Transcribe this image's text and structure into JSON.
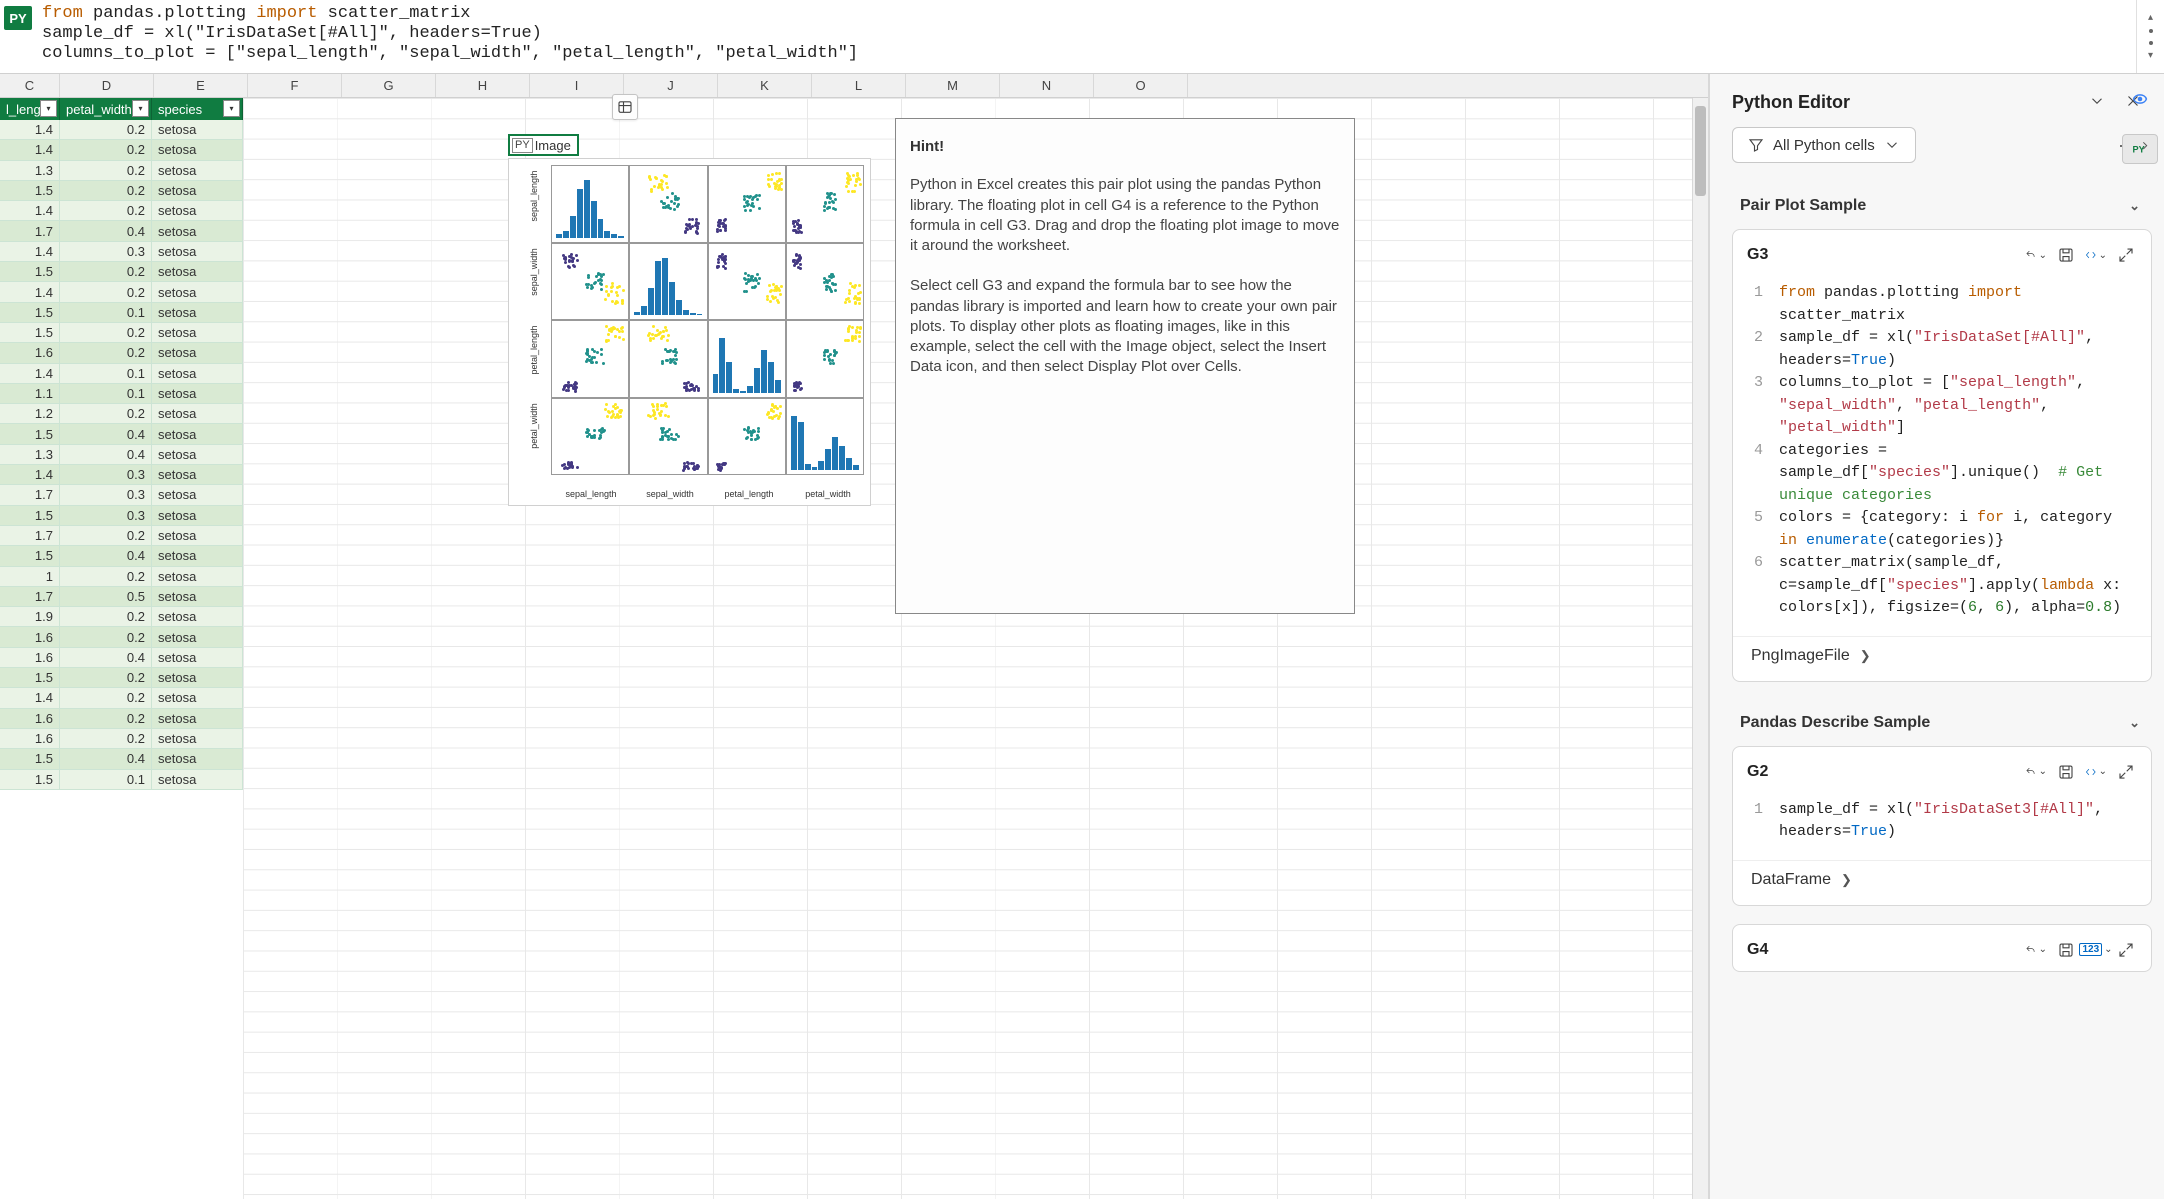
{
  "formula": {
    "indicator": "PY",
    "line1_prefix": "from",
    "line1_mod": " pandas.plotting ",
    "line1_import": "import",
    "line1_name": " scatter_matrix",
    "line2": "sample_df = xl(\"IrisDataSet[#All]\", headers=True)",
    "line3": "columns_to_plot = [\"sepal_length\", \"sepal_width\", \"petal_length\", \"petal_width\"]"
  },
  "columns": [
    "C",
    "D",
    "E",
    "F",
    "G",
    "H",
    "I",
    "J",
    "K",
    "L",
    "M",
    "N",
    "O"
  ],
  "col_w_first": 60,
  "col_w_rest": 94,
  "table_headers": [
    "l_length",
    "petal_width",
    "species"
  ],
  "table_header_widths": [
    60,
    92,
    91
  ],
  "table_rows": [
    [
      1.4,
      0.2,
      "setosa"
    ],
    [
      1.4,
      0.2,
      "setosa"
    ],
    [
      1.3,
      0.2,
      "setosa"
    ],
    [
      1.5,
      0.2,
      "setosa"
    ],
    [
      1.4,
      0.2,
      "setosa"
    ],
    [
      1.7,
      0.4,
      "setosa"
    ],
    [
      1.4,
      0.3,
      "setosa"
    ],
    [
      1.5,
      0.2,
      "setosa"
    ],
    [
      1.4,
      0.2,
      "setosa"
    ],
    [
      1.5,
      0.1,
      "setosa"
    ],
    [
      1.5,
      0.2,
      "setosa"
    ],
    [
      1.6,
      0.2,
      "setosa"
    ],
    [
      1.4,
      0.1,
      "setosa"
    ],
    [
      1.1,
      0.1,
      "setosa"
    ],
    [
      1.2,
      0.2,
      "setosa"
    ],
    [
      1.5,
      0.4,
      "setosa"
    ],
    [
      1.3,
      0.4,
      "setosa"
    ],
    [
      1.4,
      0.3,
      "setosa"
    ],
    [
      1.7,
      0.3,
      "setosa"
    ],
    [
      1.5,
      0.3,
      "setosa"
    ],
    [
      1.7,
      0.2,
      "setosa"
    ],
    [
      1.5,
      0.4,
      "setosa"
    ],
    [
      1,
      0.2,
      "setosa"
    ],
    [
      1.7,
      0.5,
      "setosa"
    ],
    [
      1.9,
      0.2,
      "setosa"
    ],
    [
      1.6,
      0.2,
      "setosa"
    ],
    [
      1.6,
      0.4,
      "setosa"
    ],
    [
      1.5,
      0.2,
      "setosa"
    ],
    [
      1.4,
      0.2,
      "setosa"
    ],
    [
      1.6,
      0.2,
      "setosa"
    ],
    [
      1.6,
      0.2,
      "setosa"
    ],
    [
      1.5,
      0.4,
      "setosa"
    ],
    [
      1.5,
      0.1,
      "setosa"
    ]
  ],
  "image_cell_label": "Image",
  "pair_plot": {
    "labels": [
      "sepal_length",
      "sepal_width",
      "petal_length",
      "petal_width"
    ]
  },
  "hint": {
    "title": "Hint!",
    "p1": "Python in Excel creates this pair plot using the pandas Python library. The floating plot in cell G4 is a reference to the Python formula in cell G3. Drag and drop the floating plot image to move it around the worksheet.",
    "p2": "Select cell G3 and expand the formula bar to see how the pandas library is imported and learn how to create your own pair plots. To display other plots as floating images, like in this example, select the cell with the Image object, select the Insert Data icon, and then select Display Plot over Cells."
  },
  "panel": {
    "title": "Python Editor",
    "filter_label": "All Python cells",
    "sections": [
      {
        "title": "Pair Plot Sample",
        "card": {
          "cell_ref": "G3",
          "code": [
            {
              "n": "1",
              "html": "<span class='tk-kw'>from</span> pandas.plotting <span class='tk-kw'>import</span> scatter_matrix"
            },
            {
              "n": "2",
              "html": "sample_df = xl(<span class='tk-str'>\"IrisDataSet[#All]\"</span>, headers=<span class='tk-bool'>True</span>)"
            },
            {
              "n": "3",
              "html": "columns_to_plot = [<span class='tk-str'>\"sepal_length\"</span>, <span class='tk-str'>\"sepal_width\"</span>, <span class='tk-str'>\"petal_length\"</span>, <span class='tk-str'>\"petal_width\"</span>]"
            },
            {
              "n": "4",
              "html": "categories = sample_df[<span class='tk-str'>\"species\"</span>].unique()  <span class='tk-cmt'># Get unique categories</span>"
            },
            {
              "n": "5",
              "html": "colors = {category: i <span class='tk-kw'>for</span> i, category <span class='tk-kw'>in</span> <span class='tk-fn'>enumerate</span>(categories)}"
            },
            {
              "n": "6",
              "html": "scatter_matrix(sample_df, c=sample_df[<span class='tk-str'>\"species\"</span>].apply(<span class='tk-kw'>lambda</span> x: colors[x]), figsize=(<span class='tk-num'>6</span>, <span class='tk-num'>6</span>), alpha=<span class='tk-num'>0.8</span>)"
            }
          ],
          "footer": "PngImageFile"
        }
      },
      {
        "title": "Pandas Describe Sample",
        "card": {
          "cell_ref": "G2",
          "code": [
            {
              "n": "1",
              "html": "sample_df = xl(<span class='tk-str'>\"IrisDataSet3[#All]\"</span>, headers=<span class='tk-bool'>True</span>)"
            }
          ],
          "footer": "DataFrame"
        }
      },
      {
        "title": "",
        "card": {
          "cell_ref": "G4",
          "code": [],
          "footer": "",
          "third_output_badge": "123"
        }
      }
    ]
  }
}
